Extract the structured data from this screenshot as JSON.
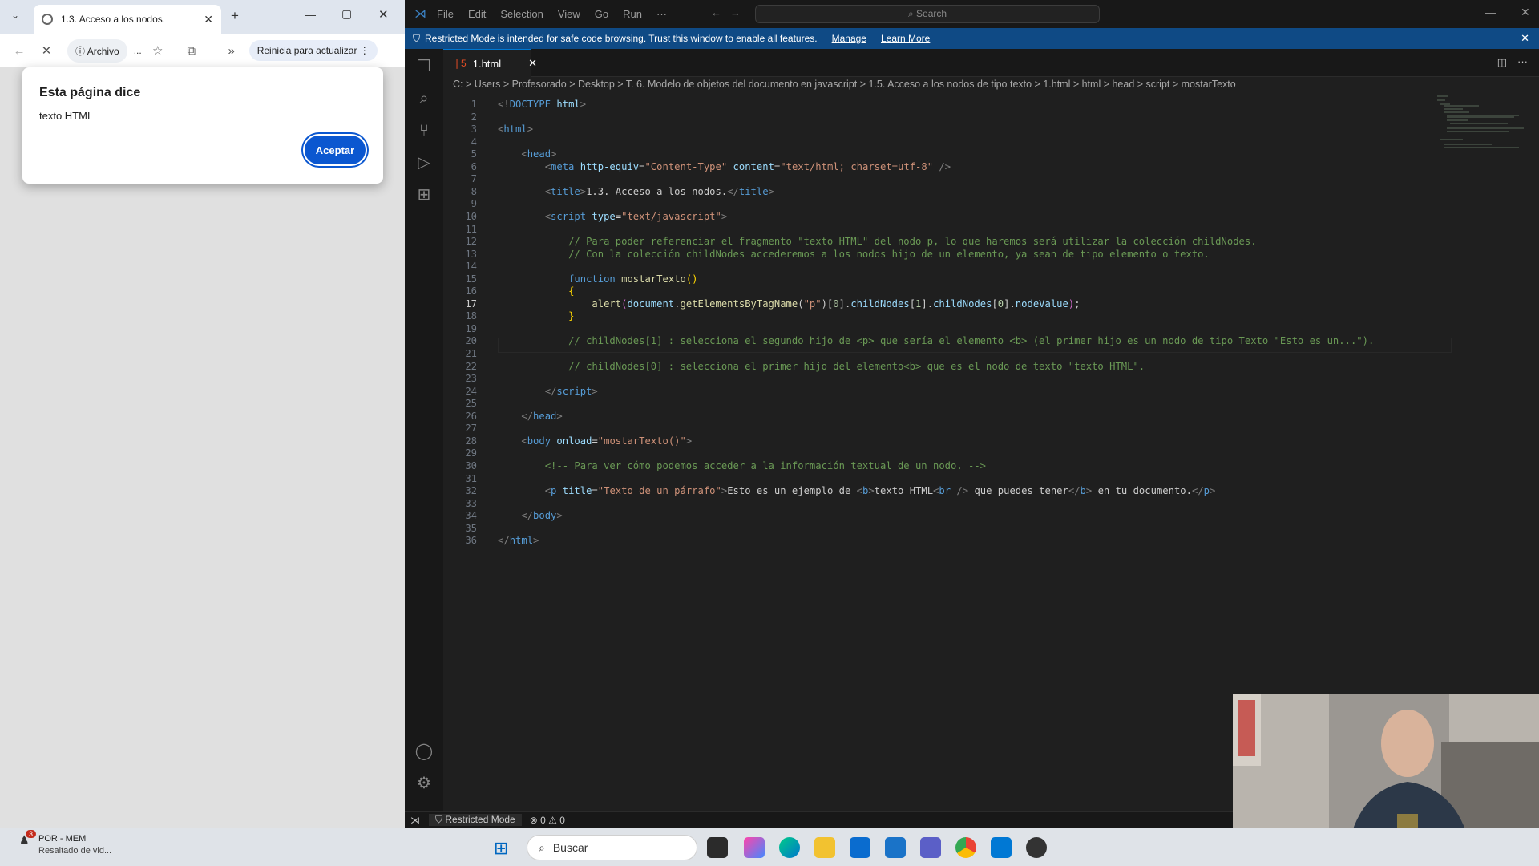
{
  "browser": {
    "tab_title": "1.3. Acceso a los nodos.",
    "site_chip": "Archivo",
    "ellipsis": "...",
    "update_button": "Reinicia para actualizar",
    "dialog": {
      "heading": "Esta página dice",
      "message": "texto HTML",
      "ok": "Aceptar"
    }
  },
  "vscode": {
    "menu": [
      "File",
      "Edit",
      "Selection",
      "View",
      "Go",
      "Run",
      "···"
    ],
    "search_placeholder": "Search",
    "banner": {
      "text": "Restricted Mode is intended for safe code browsing. Trust this window to enable all features.",
      "manage": "Manage",
      "learn": "Learn More"
    },
    "tab_label": "1.html",
    "breadcrumb": "C: > Users > Profesorado > Desktop > T. 6. Modelo de objetos del documento en javascript > 1.5. Acceso a los nodos de tipo texto > 1.html > html > head > script > mostarTexto",
    "lines": [
      "1",
      "2",
      "3",
      "4",
      "5",
      "6",
      "7",
      "8",
      "9",
      "10",
      "11",
      "12",
      "13",
      "14",
      "15",
      "16",
      "17",
      "18",
      "19",
      "20",
      "21",
      "22",
      "23",
      "24",
      "25",
      "26",
      "27",
      "28",
      "29",
      "30",
      "31",
      "32",
      "33",
      "34",
      "35",
      "36"
    ],
    "status": {
      "mode": "Restricted Mode",
      "errors": "0",
      "warnings": "0"
    }
  },
  "taskbar": {
    "notif_title": "POR - MEM",
    "notif_sub": "Resaltado de vid...",
    "notif_count": "3",
    "search": "Buscar"
  },
  "colors": {
    "accent": "#0078d4",
    "banner": "#0f4a85",
    "dialog_button": "#0b57d0"
  }
}
